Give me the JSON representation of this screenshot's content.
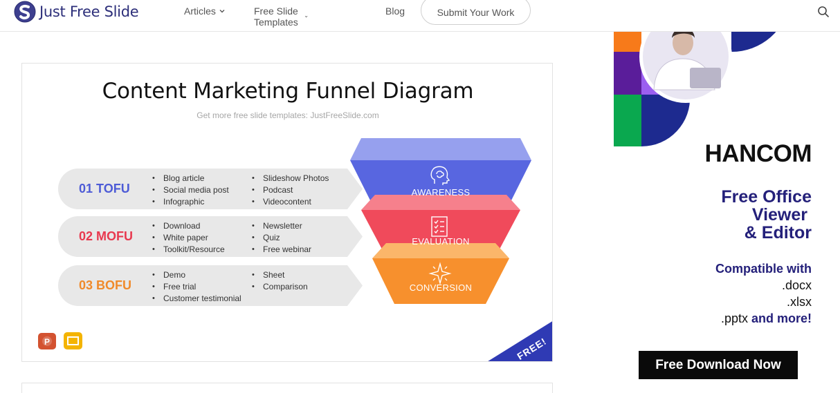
{
  "header": {
    "logo_text": "Just Free Slide",
    "nav": [
      {
        "label": "Articles"
      },
      {
        "label": "Free Slide Templates"
      },
      {
        "label": "Blog"
      }
    ],
    "submit_label": "Submit Your Work"
  },
  "slide": {
    "title": "Content Marketing Funnel Diagram",
    "subtitle": "Get more free slide templates: JustFreeSlide.com",
    "rows": [
      {
        "label": "01 TOFU",
        "color": "#4d5bd6",
        "col1": [
          "Blog article",
          "Social media post",
          "Infographic"
        ],
        "col2": [
          "Slideshow Photos",
          "Podcast",
          "Videocontent"
        ]
      },
      {
        "label": "02 MOFU",
        "color": "#e8394f",
        "col1": [
          "Download",
          "White paper",
          "Toolkit/Resource"
        ],
        "col2": [
          "Newsletter",
          "Quiz",
          "Free webinar"
        ]
      },
      {
        "label": "03 BOFU",
        "color": "#f08a2a",
        "col1": [
          "Demo",
          "Free trial",
          "Customer testimonial"
        ],
        "col2": [
          "Sheet",
          "Comparison"
        ]
      }
    ],
    "funnel": [
      "AWARENESS",
      "EVALUATION",
      "CONVERSION"
    ],
    "ribbon": "FREE!",
    "colors": {
      "blue": "#5866e0",
      "red": "#f04a5b",
      "orange": "#f7902d"
    },
    "icons": [
      "brain-head-icon",
      "checklist-icon",
      "sparkle-icon"
    ]
  },
  "ad": {
    "brand": "HANCOM",
    "headline": [
      "Free Office",
      "Viewer",
      "& Editor"
    ],
    "compat_lead": "Compatible with",
    "formats": [
      ".docx",
      ".xlsx",
      ".pptx"
    ],
    "compat_tail": "and more!",
    "button": "Free Download Now"
  }
}
